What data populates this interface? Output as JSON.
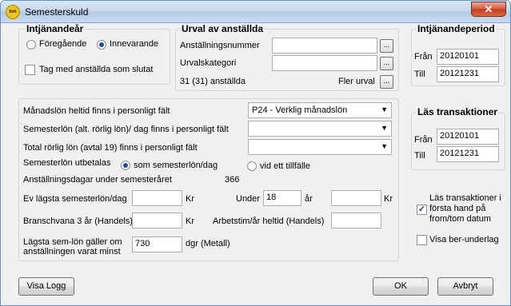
{
  "window": {
    "title": "Semesterskuld",
    "icon": "app-logo-icon",
    "logo_text": "Ion",
    "close_glyph": "✕"
  },
  "intjanandear": {
    "title": "Intjänandeår",
    "opt_foregaende": "Föregående",
    "opt_innevarande": "Innevarande",
    "selected": "Innevarande",
    "slutat_label": "Tag med anställda som slutat",
    "slutat_checked": false
  },
  "urval": {
    "title": "Urval av anställda",
    "anstallningsnummer_label": "Anställningsnummer",
    "anstallningsnummer_value": "",
    "urvalskategori_label": "Urvalskategori",
    "urvalskategori_value": "",
    "count_text": "31 (31) anställda",
    "fler_urval_label": "Fler urval",
    "dots": "..."
  },
  "intjanandeperiod": {
    "title": "Intjänandeperiod",
    "fran_label": "Från",
    "fran_value": "20120101",
    "till_label": "Till",
    "till_value": "20121231"
  },
  "las_transaktioner": {
    "title": "Läs transaktioner",
    "fran_label": "Från",
    "fran_value": "20120101",
    "till_label": "Till",
    "till_value": "20121231"
  },
  "main": {
    "manadslon_label": "Månadslön heltid finns i personligt fält",
    "manadslon_value": "P24 - Verklig månadslön",
    "semesterlon_label": "Semesterlön (alt. rörlig lön)/ dag finns i personligt fält",
    "semesterlon_value": "",
    "total_rorlig_label": "Total rörlig lön (avtal 19)  finns i personligt fält",
    "total_rorlig_value": "",
    "utbetalas_label": "Semesterlön utbetalas",
    "opt_som_semesterlon": "som semesterlön/dag",
    "opt_vid_ett_tillfalle": "vid ett tillfälle",
    "utbetalas_selected": "som semesterlön/dag",
    "anstallningsdagar_label": "Anställningsdagar under semesteråret",
    "anstallningsdagar_value": "366",
    "lagsta_label": "Ev lägsta semesterlön/dag",
    "lagsta_value": "",
    "kr1": "Kr",
    "under_label": "Under",
    "under_value": "18",
    "ar_label": "år",
    "ar_value": "",
    "kr2": "Kr",
    "bransch_label": "Branschvana 3 år (Handels)",
    "bransch_value": "",
    "kr3": "Kr",
    "arbetstim_label": "Arbetstim/år heltid (Handels)",
    "arbetstim_value": "",
    "lagsta_sem_label_1": "Lägsta sem-lön gäller om",
    "lagsta_sem_label_2": "anställningen varat minst",
    "lagsta_sem_value": "730",
    "dgr_label": "dgr (Metall)"
  },
  "options": {
    "las_forsta_hand_1": "Läs transaktioner i",
    "las_forsta_hand_2": "första hand på",
    "las_forsta_hand_3": "from/tom datum",
    "las_forsta_hand_checked": true,
    "visa_ber_label": "Visa ber-underlag",
    "visa_ber_checked": false
  },
  "buttons": {
    "visa_logg": "Visa Logg",
    "ok": "OK",
    "avbryt": "Avbryt"
  }
}
